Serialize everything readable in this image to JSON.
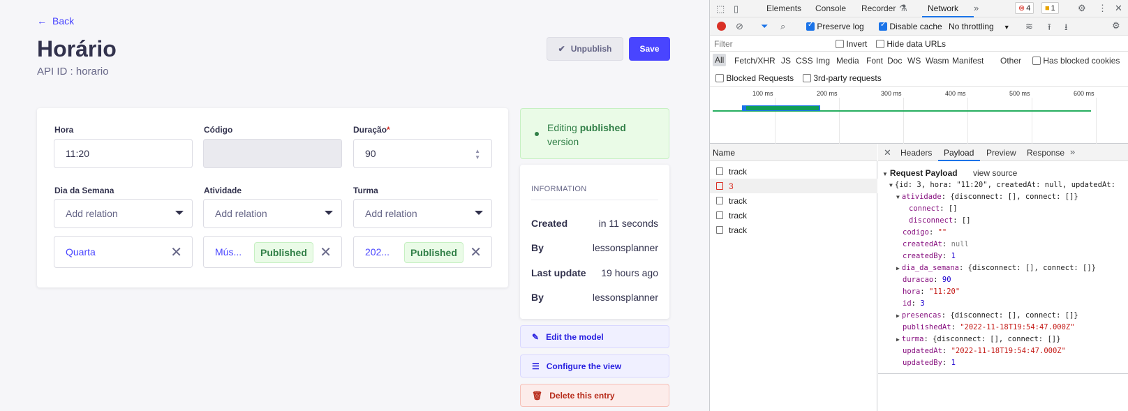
{
  "cms": {
    "back_label": "Back",
    "title": "Horário",
    "api_id": "API ID : horario",
    "unpublish_label": "Unpublish",
    "save_label": "Save",
    "fields": {
      "hora_label": "Hora",
      "hora_value": "11:20",
      "codigo_label": "Código",
      "codigo_value": "",
      "duracao_label": "Duração",
      "duracao_required": "*",
      "duracao_value": "90",
      "dia_label": "Dia da Semana",
      "atividade_label": "Atividade",
      "turma_label": "Turma",
      "add_relation": "Add relation",
      "dia_relation": "Quarta",
      "atividade_relation": "Mús...",
      "atividade_badge": "Published",
      "turma_relation": "202...",
      "turma_badge": "Published"
    },
    "editing": {
      "prefix": "Editing",
      "bold": "published",
      "suffix": "version"
    },
    "info": {
      "header": "INFORMATION",
      "created_label": "Created",
      "created_value": "in 11 seconds",
      "by_label": "By",
      "by_value": "lessonsplanner",
      "last_update_label": "Last update",
      "last_update_value": "19 hours ago",
      "by2_label": "By",
      "by2_value": "lessonsplanner"
    },
    "actions": {
      "edit_model": "Edit the model",
      "configure_view": "Configure the view",
      "delete_entry": "Delete this entry"
    }
  },
  "devtools": {
    "tabs": [
      "Elements",
      "Console",
      "Recorder",
      "Network"
    ],
    "active_tab": "Network",
    "error_count": "4",
    "warning_count": "1",
    "preserve_log": "Preserve log",
    "disable_cache": "Disable cache",
    "throttling": "No throttling",
    "filter_placeholder": "Filter",
    "invert": "Invert",
    "hide_data_urls": "Hide data URLs",
    "types": [
      "All",
      "Fetch/XHR",
      "JS",
      "CSS",
      "Img",
      "Media",
      "Font",
      "Doc",
      "WS",
      "Wasm",
      "Manifest",
      "Other"
    ],
    "has_blocked_cookies": "Has blocked cookies",
    "blocked_requests": "Blocked Requests",
    "third_party": "3rd-party requests",
    "timeline_labels": [
      "100 ms",
      "200 ms",
      "300 ms",
      "400 ms",
      "500 ms",
      "600 ms"
    ],
    "name_header": "Name",
    "requests": [
      "track",
      "3",
      "track",
      "track",
      "track"
    ],
    "detail_tabs": [
      "Headers",
      "Payload",
      "Preview",
      "Response"
    ],
    "active_detail_tab": "Payload",
    "payload_title": "Request Payload",
    "view_source": "view source",
    "payload_lines": {
      "summary": "{id: 3, hora: \"11:20\", createdAt: null, updatedAt:",
      "atividade_key": "atividade",
      "atividade_val": "{disconnect: [], connect: []}",
      "connect_key": "connect",
      "connect_val": "[]",
      "disconnect_key": "disconnect",
      "disconnect_val": "[]",
      "codigo_key": "codigo",
      "codigo_val": "\"\"",
      "createdAt_key": "createdAt",
      "createdAt_val": "null",
      "createdBy_key": "createdBy",
      "createdBy_val": "1",
      "dia_key": "dia_da_semana",
      "dia_val": "{disconnect: [], connect: []}",
      "duracao_key": "duracao",
      "duracao_val": "90",
      "hora_key": "hora",
      "hora_val": "\"11:20\"",
      "id_key": "id",
      "id_val": "3",
      "presencas_key": "presencas",
      "presencas_val": "{disconnect: [], connect: []}",
      "publishedAt_key": "publishedAt",
      "publishedAt_val": "\"2022-11-18T19:54:47.000Z\"",
      "turma_key": "turma",
      "turma_val": "{disconnect: [], connect: []}",
      "updatedAt_key": "updatedAt",
      "updatedAt_val": "\"2022-11-18T19:54:47.000Z\"",
      "updatedBy_key": "updatedBy",
      "updatedBy_val": "1"
    }
  }
}
